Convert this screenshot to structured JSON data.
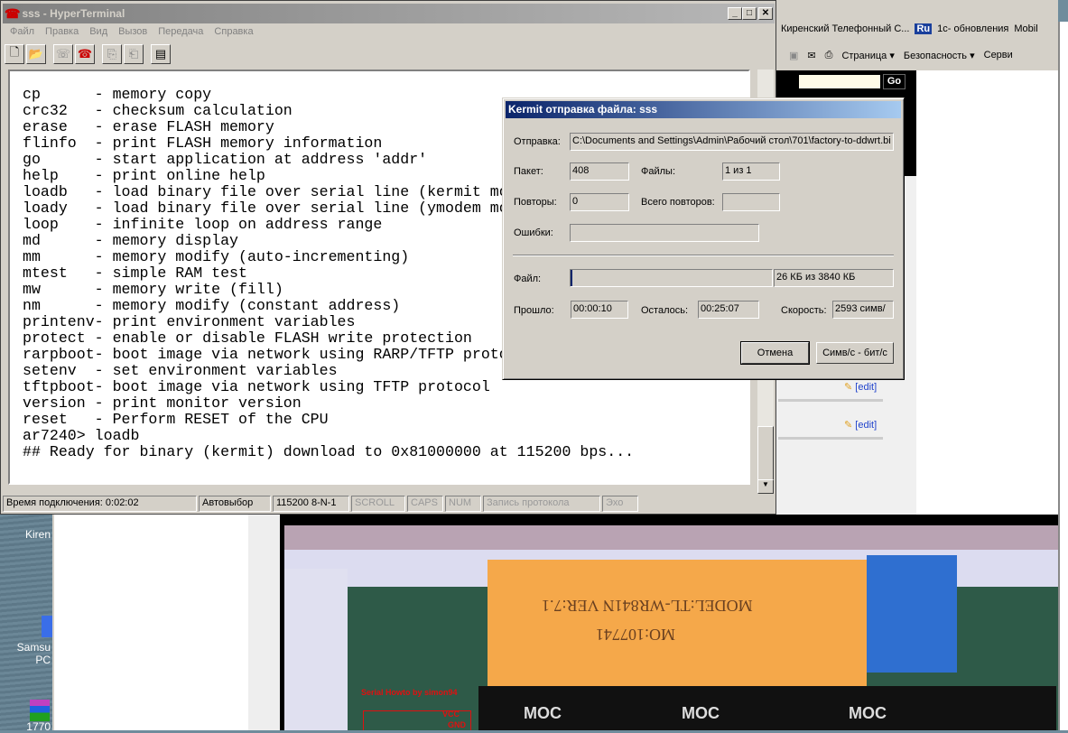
{
  "hyperterminal": {
    "title": "sss - HyperTerminal",
    "menu": [
      "Файл",
      "Правка",
      "Вид",
      "Вызов",
      "Передача",
      "Справка"
    ],
    "toolbar_icons": [
      "new-icon",
      "open-icon",
      "disconnect-icon",
      "dial-icon",
      "send-icon",
      "receive-icon",
      "properties-icon"
    ],
    "terminal_lines": [
      "cp      - memory copy",
      "crc32   - checksum calculation",
      "erase   - erase FLASH memory",
      "flinfo  - print FLASH memory information",
      "go      - start application at address 'addr'",
      "help    - print online help",
      "loadb   - load binary file over serial line (kermit mo",
      "loady   - load binary file over serial line (ymodem mo",
      "loop    - infinite loop on address range",
      "md      - memory display",
      "mm      - memory modify (auto-incrementing)",
      "mtest   - simple RAM test",
      "mw      - memory write (fill)",
      "nm      - memory modify (constant address)",
      "printenv- print environment variables",
      "protect - enable or disable FLASH write protection",
      "rarpboot- boot image via network using RARP/TFTP proto",
      "setenv  - set environment variables",
      "tftpboot- boot image via network using TFTP protocol",
      "version - print monitor version",
      "reset   - Perform RESET of the CPU",
      "ar7240> loadb",
      "## Ready for binary (kermit) download to 0x81000000 at 115200 bps..."
    ],
    "status": {
      "connected": "Время подключения: 0:02:02",
      "detect": "Автовыбор",
      "port": "115200 8-N-1",
      "scroll": "SCROLL",
      "caps": "CAPS",
      "num": "NUM",
      "capture": "Запись протокола",
      "echo": "Эхо"
    }
  },
  "kermit": {
    "title": "Kermit отправка файла: sss",
    "send_label": "Отправка:",
    "send_value": "C:\\Documents and Settings\\Admin\\Рабочий стол\\701\\factory-to-ddwrt.bi",
    "packet_label": "Пакет:",
    "packet_value": "408",
    "files_label": "Файлы:",
    "files_value": "1 из 1",
    "retries_label": "Повторы:",
    "retries_value": "0",
    "total_retries_label": "Всего повторов:",
    "total_retries_value": "",
    "errors_label": "Ошибки:",
    "errors_value": "",
    "file_label": "Файл:",
    "file_value": "26 КБ из 3840 КБ",
    "file_progress": 0.007,
    "elapsed_label": "Прошло:",
    "elapsed_value": "00:00:10",
    "remaining_label": "Осталось:",
    "remaining_value": "00:25:07",
    "speed_label": "Скорость:",
    "speed_value": "2593 симв/",
    "cancel": "Отмена",
    "toggle_units": "Симв/с - бит/с"
  },
  "browser": {
    "favorites": [
      "Киренский Телефонный С...",
      "1с- обновления",
      "Mobil"
    ],
    "ru_badge": "Ru",
    "commands": [
      "Страница ▾",
      "Безопасность ▾",
      "Серви"
    ],
    "go": "Go",
    "edit_links": [
      "[edit]",
      "[edit]"
    ]
  },
  "desktop": {
    "icons": [
      "Kiren",
      "Samsu PC",
      "1770"
    ]
  },
  "photo": {
    "label_line1": "MODEL:TL-WR841N  VER:7.1",
    "label_line2": "MO:107741",
    "chip": "MOC",
    "annotation": "Serial Howto by simon94",
    "vcc": "VCC",
    "gnd": "GND"
  }
}
